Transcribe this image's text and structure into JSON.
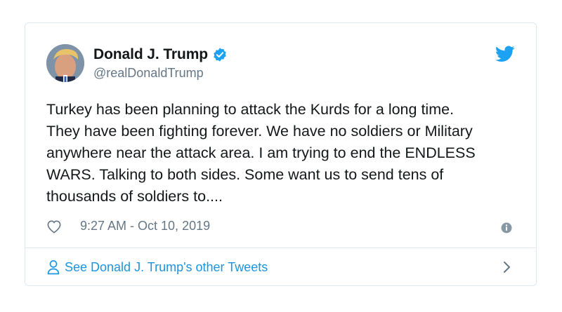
{
  "tweet": {
    "author_name": "Donald J. Trump",
    "handle": "@realDonaldTrump",
    "verified": true,
    "text": "Turkey has been planning to attack the Kurds for a long time.\nThey have been fighting forever. We have no soldiers or Military\nanywhere near the attack area. I am trying to end the ENDLESS\nWARS. Talking to both sides. Some want us to send tens of\nthousands of soldiers to....",
    "timestamp": "9:27 AM - Oct 10, 2019"
  },
  "footer": {
    "link_text": "See Donald J. Trump's other Tweets"
  },
  "icons": {
    "brand": "twitter-bird-icon",
    "verified": "verified-badge-icon",
    "like": "heart-icon",
    "info": "info-icon",
    "person": "person-icon",
    "chevron": "chevron-right-icon"
  },
  "colors": {
    "brand_blue": "#1da1f2",
    "link_blue": "#1b95e0",
    "text": "#14171a",
    "secondary": "#657786",
    "border": "#e1e8ed"
  }
}
